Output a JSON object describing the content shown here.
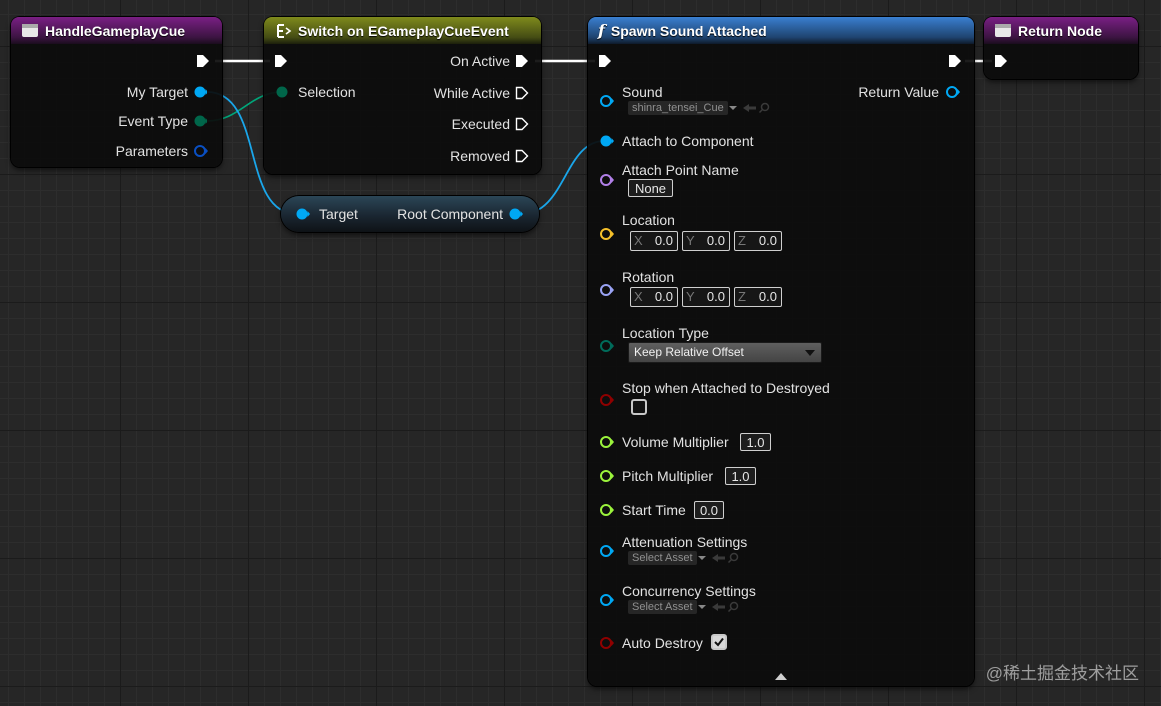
{
  "nodes": {
    "handle_gameplay_cue": {
      "title": "HandleGameplayCue",
      "pins": {
        "my_target": "My Target",
        "event_type": "Event Type",
        "parameters": "Parameters"
      }
    },
    "switch_node": {
      "title": "Switch on EGameplayCueEvent",
      "pins": {
        "selection": "Selection",
        "on_active": "On Active",
        "while_active": "While Active",
        "executed": "Executed",
        "removed": "Removed"
      }
    },
    "target_node": {
      "pins": {
        "target": "Target",
        "root_component": "Root Component"
      }
    },
    "spawn_sound": {
      "title": "Spawn Sound Attached",
      "title_icon": "f",
      "return_value": "Return Value",
      "sound": {
        "label": "Sound",
        "value": "shinra_tensei_Cue"
      },
      "attach_to_component": "Attach to Component",
      "attach_point_name": {
        "label": "Attach Point Name",
        "value": "None"
      },
      "location": {
        "label": "Location",
        "x": "0.0",
        "y": "0.0",
        "z": "0.0"
      },
      "rotation": {
        "label": "Rotation",
        "x": "0.0",
        "y": "0.0",
        "z": "0.0"
      },
      "axis": {
        "x": "X",
        "y": "Y",
        "z": "Z"
      },
      "location_type": {
        "label": "Location Type",
        "value": "Keep Relative Offset"
      },
      "stop_when_attached": {
        "label": "Stop when Attached to Destroyed",
        "checked": false
      },
      "volume_multiplier": {
        "label": "Volume Multiplier",
        "value": "1.0"
      },
      "pitch_multiplier": {
        "label": "Pitch Multiplier",
        "value": "1.0"
      },
      "start_time": {
        "label": "Start Time",
        "value": "0.0"
      },
      "attenuation_settings": {
        "label": "Attenuation Settings",
        "value": "Select Asset"
      },
      "concurrency_settings": {
        "label": "Concurrency Settings",
        "value": "Select Asset"
      },
      "auto_destroy": {
        "label": "Auto Destroy",
        "checked": true
      }
    },
    "return_node": {
      "title": "Return Node"
    }
  },
  "icons": {
    "event_header": "event-icon",
    "switch_header": "switch-icon",
    "function_header": "function-icon",
    "exec_pin": "exec-arrow-icon",
    "collapse": "collapse-arrow-icon",
    "browse": "arrow-left-icon",
    "find": "magnifier-icon"
  },
  "pin_colors": {
    "object": "#00a8f4",
    "enum": "#00664a",
    "struct": "#0a4fc2",
    "name": "#b280e8",
    "vector": "#f5c02a",
    "rotator": "#9aa3f4",
    "byte": "#006b5a",
    "bool": "#8f0000",
    "float": "#9bf33c",
    "exec": "#ffffff"
  },
  "watermark": "@稀土掘金技术社区"
}
